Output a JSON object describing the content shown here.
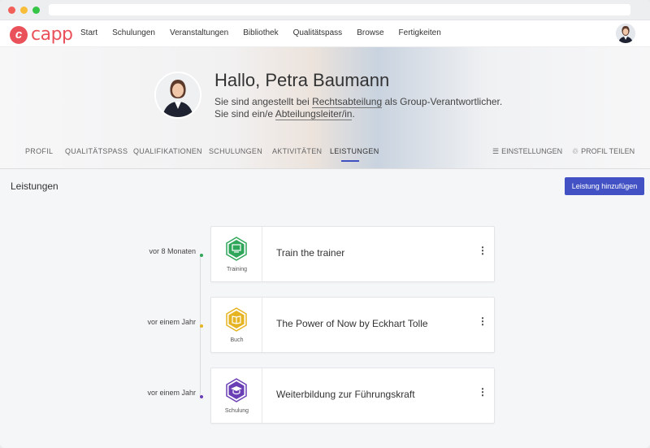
{
  "app": {
    "logo_letter": "c",
    "logo_text": "capp",
    "brand_color": "#e9525b",
    "accent_color": "#4252c4"
  },
  "nav": {
    "items": [
      "Start",
      "Schulungen",
      "Veranstaltungen",
      "Bibliothek",
      "Qualitätspass",
      "Browse",
      "Fertigkeiten"
    ]
  },
  "profile": {
    "greeting": "Hallo, Petra Baumann",
    "line1_prefix": "Sie sind angestellt bei ",
    "line1_link": "Rechtsabteilung",
    "line1_suffix": " als Group-Verantwortlicher.",
    "line2_prefix": "Sie sind ein/e ",
    "line2_link": "Abteilungsleiter/in",
    "line2_suffix": "."
  },
  "tabs": {
    "items": [
      "PROFIL",
      "QUALITÄTSPASS",
      "QUALIFIKATIONEN",
      "SCHULUNGEN",
      "AKTIVITÄTEN",
      "LEISTUNGEN"
    ],
    "active": "LEISTUNGEN",
    "settings_label": "EINSTELLUNGEN",
    "share_label": "PROFIL TEILEN"
  },
  "section": {
    "title": "Leistungen",
    "add_button": "Leistung hinzufügen"
  },
  "timeline": [
    {
      "time": "vor 8 Monaten",
      "type": "Training",
      "title": "Train the trainer",
      "color": "#2fa65a",
      "icon": "training-icon"
    },
    {
      "time": "vor einem Jahr",
      "type": "Buch",
      "title": "The Power of Now by Eckhart Tolle",
      "color": "#e6b422",
      "icon": "book-icon"
    },
    {
      "time": "vor einem Jahr",
      "type": "Schulung",
      "title": "Weiterbildung zur Führungskraft",
      "color": "#6a3fb5",
      "icon": "graduation-icon"
    }
  ],
  "more_glyph": "⋮"
}
